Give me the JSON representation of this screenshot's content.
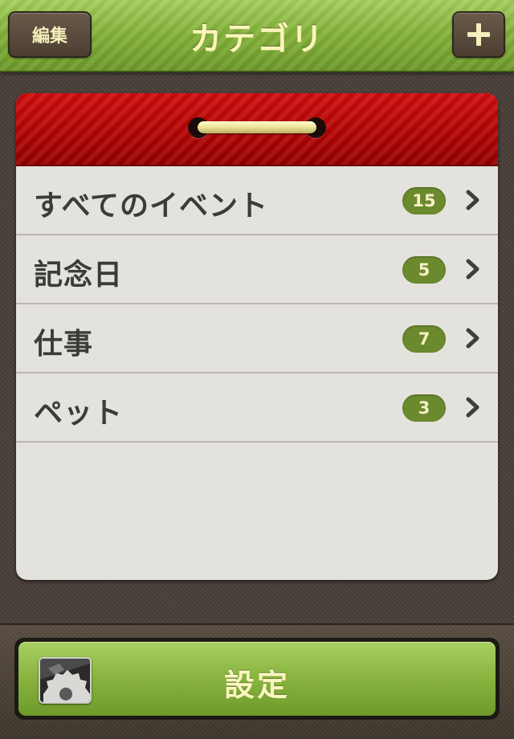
{
  "navbar": {
    "edit_label": "編集",
    "title": "カテゴリ",
    "add_icon": "plus-icon"
  },
  "categories": [
    {
      "label": "すべてのイベント",
      "count": "15"
    },
    {
      "label": "記念日",
      "count": "5"
    },
    {
      "label": "仕事",
      "count": "7"
    },
    {
      "label": "ペット",
      "count": "3"
    }
  ],
  "settings": {
    "label": "設定",
    "icon": "gear-icon"
  },
  "colors": {
    "navbar_green": "#86b43c",
    "calendar_red": "#b40404",
    "badge_green": "#6b8a2e",
    "card_paper": "#e4e2dc",
    "background_brown": "#4a4039"
  }
}
